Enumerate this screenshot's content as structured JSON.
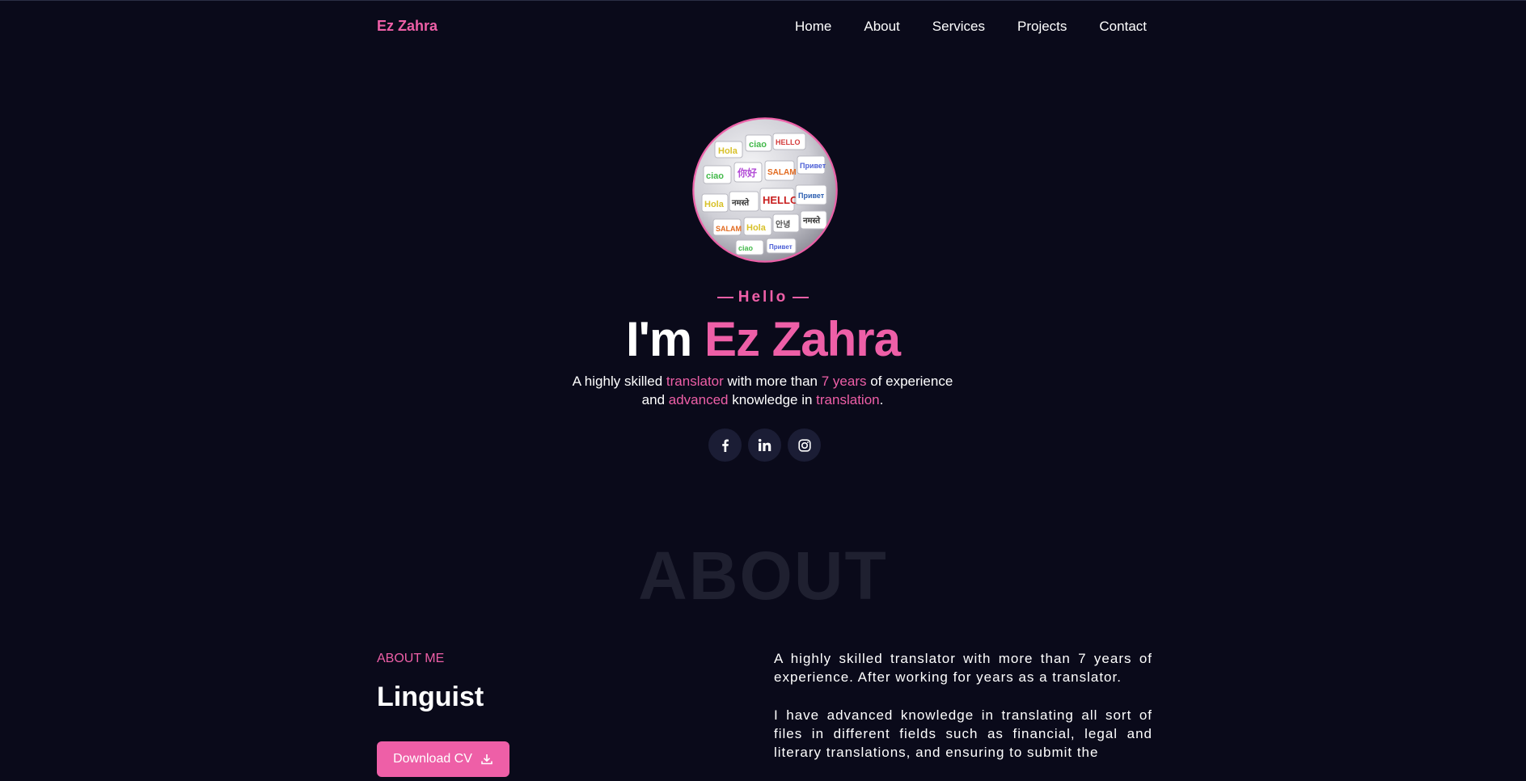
{
  "brand": "Ez Zahra",
  "nav": {
    "items": [
      {
        "label": "Home"
      },
      {
        "label": "About"
      },
      {
        "label": "Services"
      },
      {
        "label": "Projects"
      },
      {
        "label": "Contact"
      }
    ]
  },
  "hero": {
    "greeting": "Hello",
    "headline_prefix": "I'm ",
    "headline_name": "Ez Zahra",
    "tagline": {
      "t1": "A highly skilled ",
      "h1": "translator",
      "t2": " with more than ",
      "h2": "7 years",
      "t3": " of experience and ",
      "h3": "advanced",
      "t4": " knowledge in ",
      "h4": "translation",
      "t5": "."
    },
    "globe_words": [
      "Hola",
      "ciao",
      "HELLO",
      "SALAM",
      "你好",
      "नमस्ते",
      "Hola",
      "SALAM",
      "ciao",
      "Привет",
      "안녕"
    ],
    "socials": [
      {
        "icon": "facebook-icon"
      },
      {
        "icon": "linkedin-icon"
      },
      {
        "icon": "instagram-icon"
      }
    ]
  },
  "about": {
    "watermark": "ABOUT",
    "kicker": "ABOUT ME",
    "title": "Linguist",
    "download_label": "Download CV",
    "para1": "A highly skilled translator with more than 7 years of experience. After working for years as a translator.",
    "para2": "I have advanced knowledge in translating all sort of files in different fields such as financial, legal and literary translations, and ensuring to submit the"
  },
  "colors": {
    "background": "#0a0a1a",
    "accent": "#ee5fa7",
    "social_bg": "#1b1d35"
  }
}
